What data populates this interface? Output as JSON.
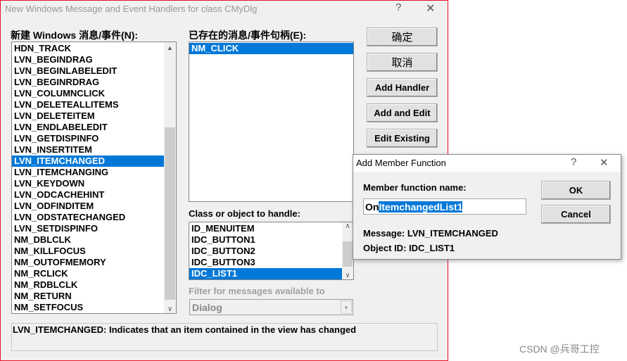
{
  "main": {
    "title": "New Windows Message and Event Handlers for class CMyDlg",
    "help": "?",
    "close": "✕",
    "new_label": "新建 Windows 消息/事件(N):",
    "existing_label": "已存在的消息/事件句柄(E):",
    "messages": [
      "HDN_TRACK",
      "LVN_BEGINDRAG",
      "LVN_BEGINLABELEDIT",
      "LVN_BEGINRDRAG",
      "LVN_COLUMNCLICK",
      "LVN_DELETEALLITEMS",
      "LVN_DELETEITEM",
      "LVN_ENDLABELEDIT",
      "LVN_GETDISPINFO",
      "LVN_INSERTITEM",
      "LVN_ITEMCHANGED",
      "LVN_ITEMCHANGING",
      "LVN_KEYDOWN",
      "LVN_ODCACHEHINT",
      "LVN_ODFINDITEM",
      "LVN_ODSTATECHANGED",
      "LVN_SETDISPINFO",
      "NM_DBLCLK",
      "NM_KILLFOCUS",
      "NM_OUTOFMEMORY",
      "NM_RCLICK",
      "NM_RDBLCLK",
      "NM_RETURN",
      "NM_SETFOCUS"
    ],
    "selected_message": "LVN_ITEMCHANGED",
    "handlers": [
      "NM_CLICK"
    ],
    "class_label": "Class or object to handle:",
    "classes": [
      "ID_MENUITEM",
      "IDC_BUTTON1",
      "IDC_BUTTON2",
      "IDC_BUTTON3",
      "IDC_LIST1"
    ],
    "selected_class": "IDC_LIST1",
    "filter_label": "Filter for messages available to",
    "filter_value": "Dialog",
    "buttons": {
      "ok": "确定",
      "cancel": "取消",
      "add_handler": "Add Handler",
      "add_edit": "Add and Edit",
      "edit_existing": "Edit Existing"
    },
    "description": "LVN_ITEMCHANGED:  Indicates that an item contained in the view has changed"
  },
  "sub": {
    "title": "Add Member Function",
    "help": "?",
    "close": "✕",
    "name_label": "Member function name:",
    "name_prefix": "On",
    "name_selected": "ItemchangedList1",
    "ok": "OK",
    "cancel": "Cancel",
    "message": "Message: LVN_ITEMCHANGED",
    "object_id": "Object ID: IDC_LIST1"
  },
  "watermark": "CSDN @兵哥工控",
  "colors": {
    "selection": "#0078d7",
    "border": "#e81123"
  }
}
